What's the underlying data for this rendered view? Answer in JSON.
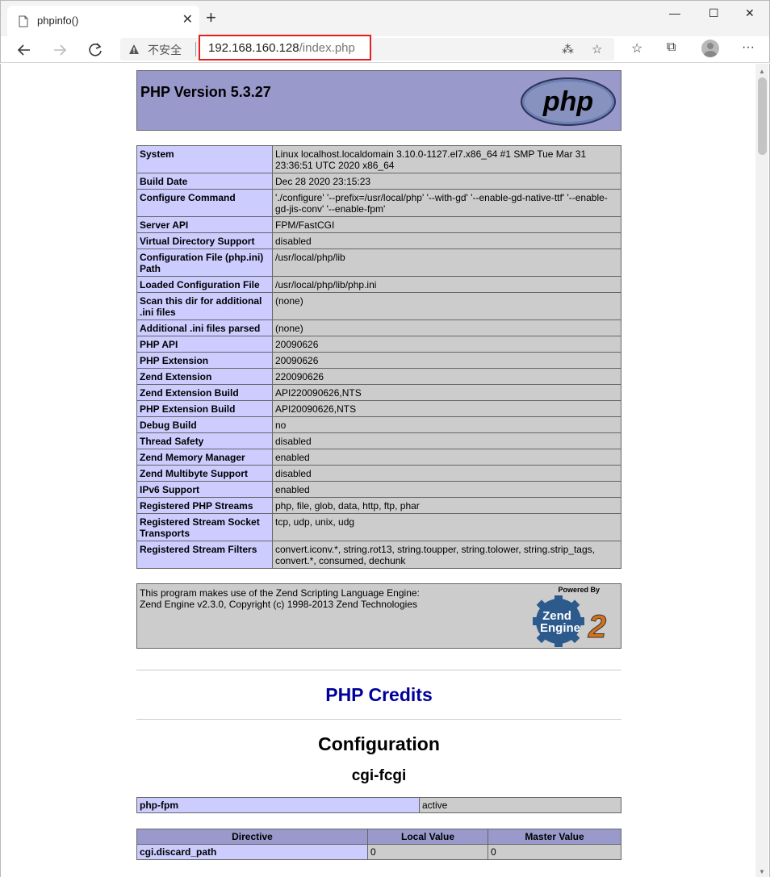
{
  "browser": {
    "tab_title": "phpinfo()",
    "insecure_label": "不安全",
    "url_host": "192.168.160.128",
    "url_path": "/index.php"
  },
  "header": {
    "title": "PHP Version 5.3.27",
    "logo_text": "php"
  },
  "info_rows": [
    {
      "key": "System",
      "value": "Linux localhost.localdomain 3.10.0-1127.el7.x86_64 #1 SMP Tue Mar 31 23:36:51 UTC 2020 x86_64"
    },
    {
      "key": "Build Date",
      "value": "Dec 28 2020 23:15:23"
    },
    {
      "key": "Configure Command",
      "value": "'./configure' '--prefix=/usr/local/php' '--with-gd' '--enable-gd-native-ttf' '--enable-gd-jis-conv' '--enable-fpm'"
    },
    {
      "key": "Server API",
      "value": "FPM/FastCGI"
    },
    {
      "key": "Virtual Directory Support",
      "value": "disabled"
    },
    {
      "key": "Configuration File (php.ini) Path",
      "value": "/usr/local/php/lib"
    },
    {
      "key": "Loaded Configuration File",
      "value": "/usr/local/php/lib/php.ini"
    },
    {
      "key": "Scan this dir for additional .ini files",
      "value": "(none)"
    },
    {
      "key": "Additional .ini files parsed",
      "value": "(none)"
    },
    {
      "key": "PHP API",
      "value": "20090626"
    },
    {
      "key": "PHP Extension",
      "value": "20090626"
    },
    {
      "key": "Zend Extension",
      "value": "220090626"
    },
    {
      "key": "Zend Extension Build",
      "value": "API220090626,NTS"
    },
    {
      "key": "PHP Extension Build",
      "value": "API20090626,NTS"
    },
    {
      "key": "Debug Build",
      "value": "no"
    },
    {
      "key": "Thread Safety",
      "value": "disabled"
    },
    {
      "key": "Zend Memory Manager",
      "value": "enabled"
    },
    {
      "key": "Zend Multibyte Support",
      "value": "disabled"
    },
    {
      "key": "IPv6 Support",
      "value": "enabled"
    },
    {
      "key": "Registered PHP Streams",
      "value": "php, file, glob, data, http, ftp, phar"
    },
    {
      "key": "Registered Stream Socket Transports",
      "value": "tcp, udp, unix, udg"
    },
    {
      "key": "Registered Stream Filters",
      "value": "convert.iconv.*, string.rot13, string.toupper, string.tolower, string.strip_tags, convert.*, consumed, dechunk"
    }
  ],
  "zend": {
    "line1": "This program makes use of the Zend Scripting Language Engine:",
    "line2": "Zend Engine v2.3.0, Copyright (c) 1998-2013 Zend Technologies",
    "powered_by": "Powered By",
    "logo_word1": "Zend",
    "logo_word2": "Engine",
    "logo_num": "2"
  },
  "credits_link": "PHP Credits",
  "configuration_heading": "Configuration",
  "module_heading": "cgi-fcgi",
  "module_row": {
    "key": "php-fpm",
    "value": "active"
  },
  "directive_table": {
    "headers": [
      "Directive",
      "Local Value",
      "Master Value"
    ],
    "rows": [
      {
        "directive": "cgi.discard_path",
        "local": "0",
        "master": "0"
      }
    ]
  }
}
